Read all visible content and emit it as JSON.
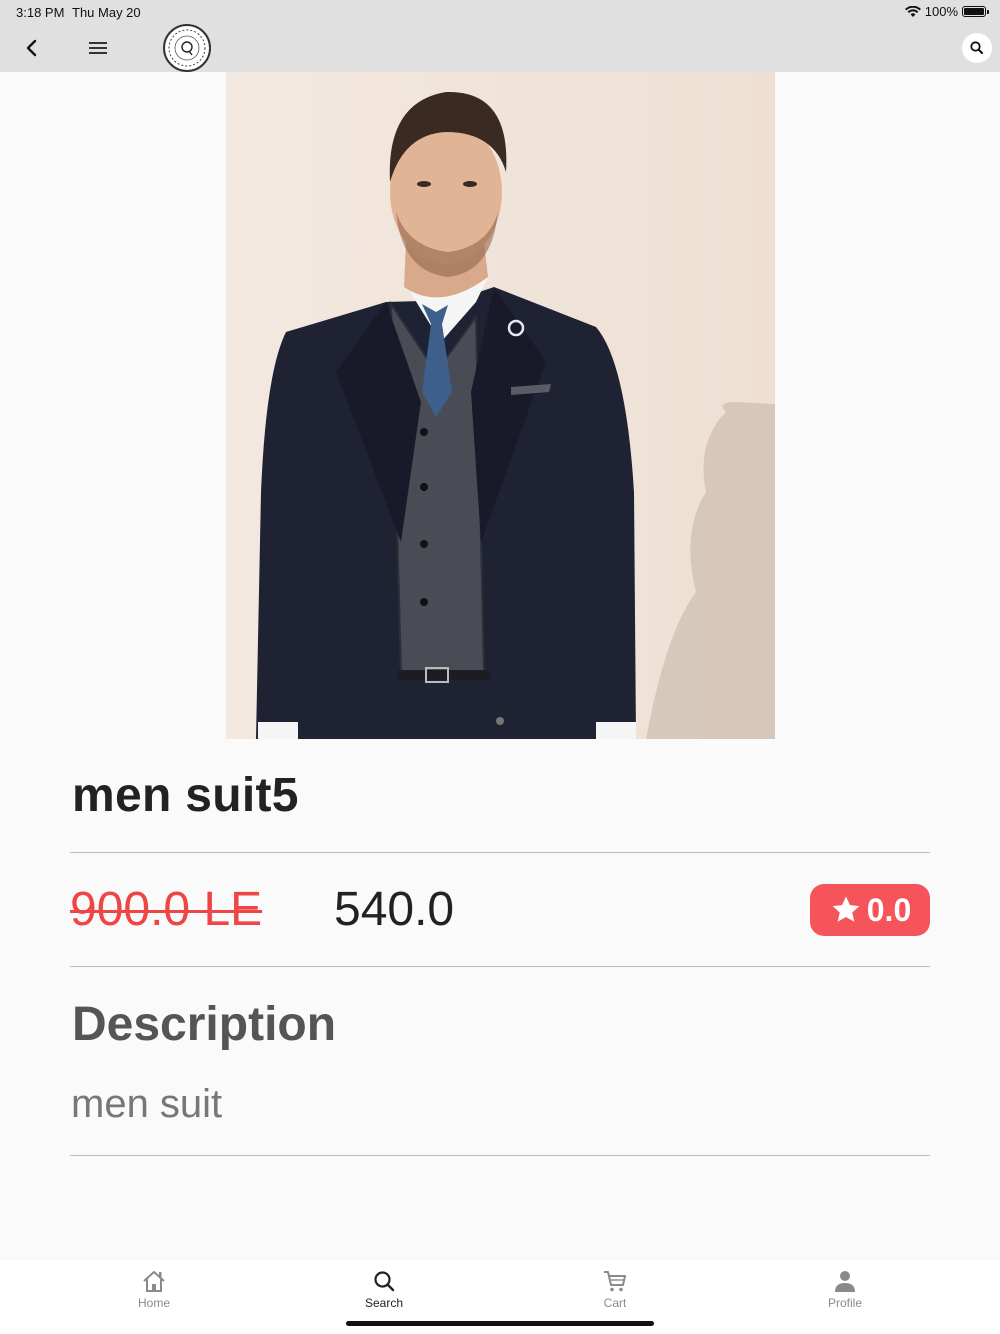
{
  "status_bar": {
    "time": "3:18 PM",
    "date": "Thu May 20",
    "battery": "100%"
  },
  "app_bar": {
    "back_icon": "chevron-left-icon",
    "menu_icon": "hamburger-menu-icon",
    "logo_icon": "brand-logo-icon",
    "search_icon": "search-icon",
    "background": "#e0e0e0"
  },
  "product": {
    "image_icon": "product-photo-men-suit",
    "image_page_indicator": {
      "current": 1,
      "total": 1
    },
    "title": "men suit5",
    "old_price": "900.0 LE",
    "new_price": "540.0",
    "rating": "0.0",
    "rating_color": "#f5545a",
    "old_price_color": "#f04545"
  },
  "description": {
    "heading": "Description",
    "text": "men suit"
  },
  "bottom_nav": {
    "items": [
      {
        "label": "Home",
        "icon": "home-icon"
      },
      {
        "label": "Search",
        "icon": "search-icon"
      },
      {
        "label": "Cart",
        "icon": "cart-icon"
      },
      {
        "label": "Profile",
        "icon": "profile-icon"
      }
    ],
    "active": "Search"
  }
}
